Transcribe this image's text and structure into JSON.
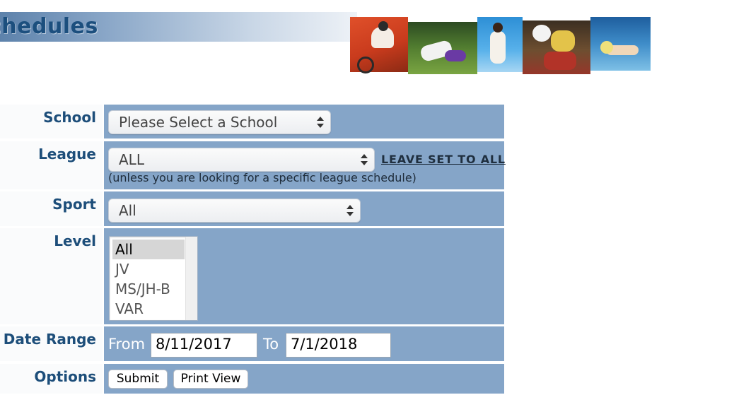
{
  "header": {
    "title": "chedules"
  },
  "form": {
    "school": {
      "label": "School",
      "selected": "Please Select a School"
    },
    "league": {
      "label": "League",
      "selected": "ALL",
      "link": "LEAVE SET TO ALL",
      "hint": "(unless you are looking for a specific league schedule)"
    },
    "sport": {
      "label": "Sport",
      "selected": "All"
    },
    "level": {
      "label": "Level",
      "options": [
        "All",
        "JV",
        "MS/JH-B",
        "VAR"
      ],
      "selected": "All"
    },
    "date_range": {
      "label": "Date Range",
      "from_label": "From",
      "from_value": "8/11/2017",
      "to_label": "To",
      "to_value": "7/1/2018"
    },
    "options": {
      "label": "Options",
      "submit": "Submit",
      "print_view": "Print View"
    }
  },
  "colors": {
    "field_background": "#85a5c8",
    "label_text": "#1d4e7a",
    "banner_text": "#1c4f7e"
  }
}
